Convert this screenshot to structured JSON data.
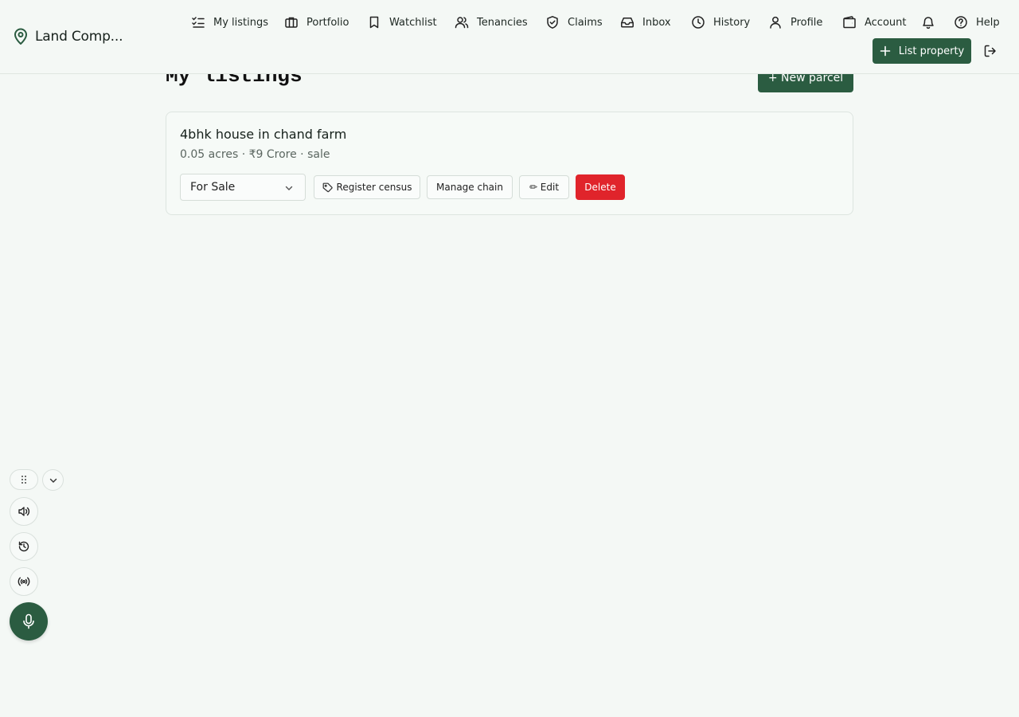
{
  "brand": {
    "name": "Land Comp..."
  },
  "nav": {
    "items": [
      {
        "label": "My listings",
        "icon": "list-check-icon"
      },
      {
        "label": "Portfolio",
        "icon": "briefcase-icon"
      },
      {
        "label": "Watchlist",
        "icon": "bookmark-icon"
      },
      {
        "label": "Tenancies",
        "icon": "users-icon"
      },
      {
        "label": "Claims",
        "icon": "shield-check-icon"
      },
      {
        "label": "Inbox",
        "icon": "inbox-icon"
      },
      {
        "label": "History",
        "icon": "clock-icon"
      },
      {
        "label": "Profile",
        "icon": "user-icon"
      },
      {
        "label": "Account",
        "icon": "wallet-icon"
      },
      {
        "label": "Help",
        "icon": "help-circle-icon"
      }
    ],
    "list_property_label": "List property"
  },
  "page": {
    "title": "My listings",
    "new_parcel_label": "+ New parcel"
  },
  "listings": [
    {
      "title": "4bhk house in chand farm",
      "meta": "0.05 acres · ₹9 Crore · sale",
      "status": "For Sale",
      "actions": {
        "register": "Register census",
        "chain": "Manage chain",
        "edit": "✏ Edit",
        "delete": "Delete"
      }
    }
  ],
  "colors": {
    "accent": "#2b5c41",
    "danger": "#e0242b",
    "background": "#f4f8f5"
  }
}
